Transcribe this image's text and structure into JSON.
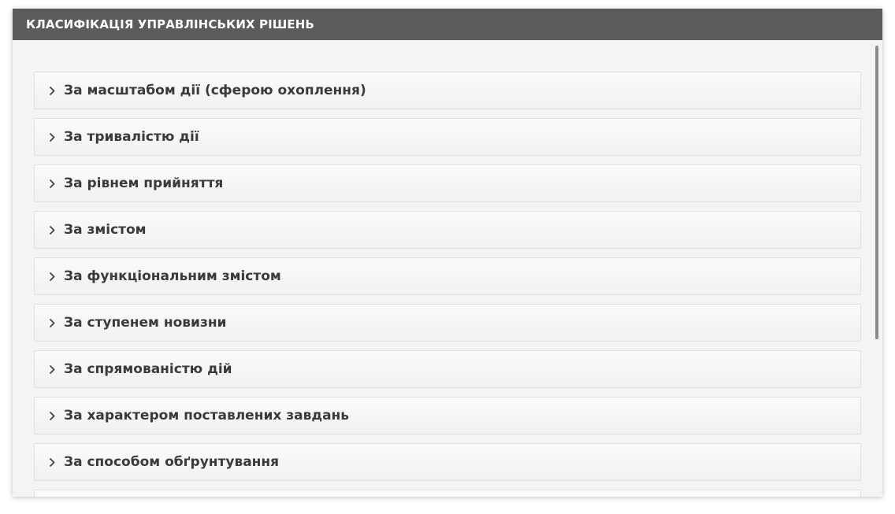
{
  "panel": {
    "title": "КЛАСИФІКАЦІЯ УПРАВЛІНСЬКИХ РІШЕНЬ"
  },
  "accordion": {
    "items": [
      {
        "label": "За масштабом дії (сферою охоплення)",
        "icon": "chevron-right-icon"
      },
      {
        "label": "За тривалістю дії",
        "icon": "chevron-right-icon"
      },
      {
        "label": "За рівнем прийняття",
        "icon": "chevron-right-icon"
      },
      {
        "label": "За змістом",
        "icon": "chevron-right-icon"
      },
      {
        "label": "За функціональним змістом",
        "icon": "chevron-right-icon"
      },
      {
        "label": "За ступенем новизни",
        "icon": "chevron-right-icon"
      },
      {
        "label": "За спрямованістю дій",
        "icon": "chevron-right-icon"
      },
      {
        "label": "За характером поставлених завдань",
        "icon": "chevron-right-icon"
      },
      {
        "label": "За способом обґрунтування",
        "icon": "chevron-right-icon"
      },
      {
        "label": "",
        "icon": "chevron-right-icon"
      }
    ]
  },
  "colors": {
    "header_bg": "#5b5b5b",
    "header_text": "#ffffff",
    "item_text": "#3a3a3a",
    "panel_bg": "#f4f4f4"
  }
}
